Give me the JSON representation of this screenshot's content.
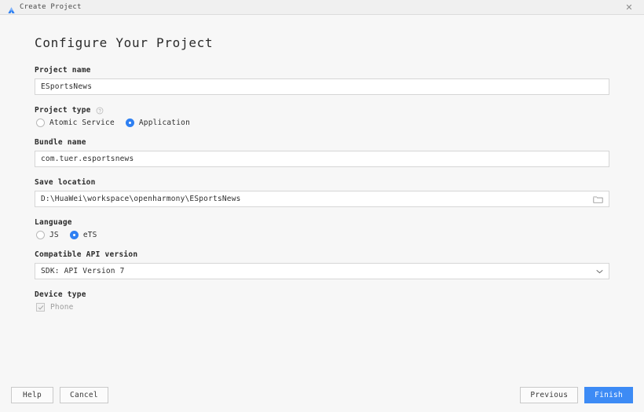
{
  "window": {
    "title": "Create Project",
    "logo_icon": "deveco-studio-logo-icon",
    "close_icon": "✕"
  },
  "page": {
    "heading": "Configure Your Project"
  },
  "form": {
    "project_name": {
      "label": "Project name",
      "value": "ESportsNews",
      "placeholder": "Project name"
    },
    "project_type": {
      "label": "Project type",
      "help_icon": "help-circle-icon",
      "options": [
        {
          "label": "Atomic Service",
          "selected": false
        },
        {
          "label": "Application",
          "selected": true
        }
      ]
    },
    "bundle_name": {
      "label": "Bundle name",
      "value": "com.tuer.esportsnews",
      "placeholder": "Bundle name"
    },
    "save_location": {
      "label": "Save location",
      "value": "D:\\HuaWei\\workspace\\openharmony\\ESportsNews",
      "placeholder": "Save location",
      "browse_icon": "folder-icon"
    },
    "language": {
      "label": "Language",
      "options": [
        {
          "label": "JS",
          "selected": false
        },
        {
          "label": "eTS",
          "selected": true
        }
      ]
    },
    "api_version": {
      "label": "Compatible API version",
      "value": "SDK: API Version 7",
      "dropdown_icon": "chevron-down-icon"
    },
    "device_type": {
      "label": "Device type",
      "options": [
        {
          "label": "Phone",
          "checked": true,
          "disabled": true
        }
      ]
    }
  },
  "footer": {
    "help_label": "Help",
    "cancel_label": "Cancel",
    "previous_label": "Previous",
    "finish_label": "Finish"
  },
  "colors": {
    "accent": "#3d8bf5",
    "radio_accent": "#2f80f2",
    "titlebar_bg": "#f0f0f0",
    "content_bg": "#f7f7f7",
    "input_bg": "#ffffff",
    "border": "#d6d6d6",
    "disabled_text": "#9d9d9d"
  }
}
